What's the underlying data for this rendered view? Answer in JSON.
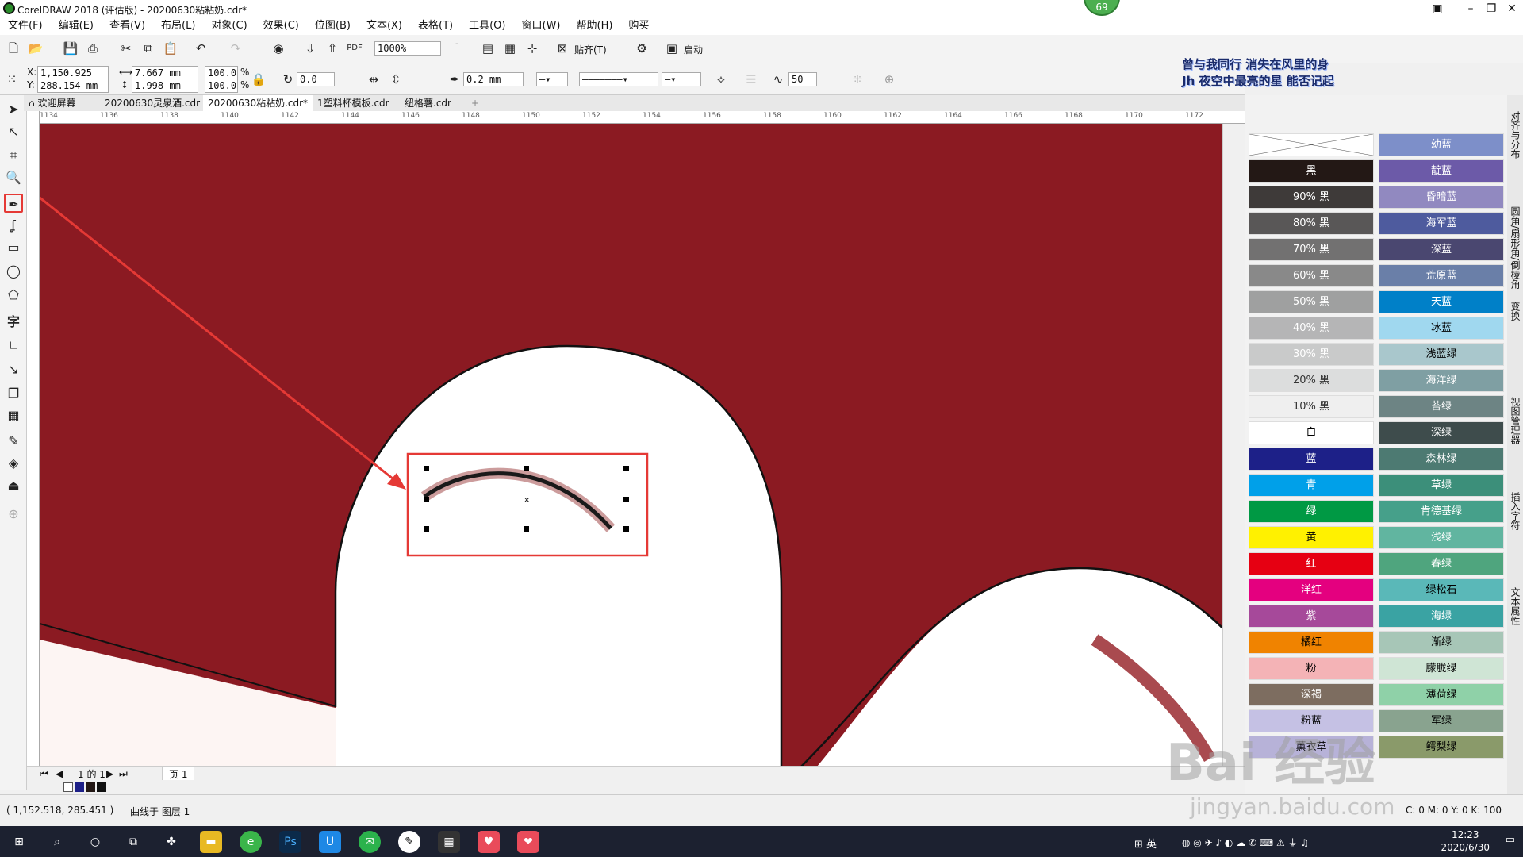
{
  "window": {
    "title": "CorelDRAW 2018 (评估版) - 20200630粘粘奶.cdr*",
    "badge": "69"
  },
  "menu": [
    "文件(F)",
    "编辑(E)",
    "查看(V)",
    "布局(L)",
    "对象(C)",
    "效果(C)",
    "位图(B)",
    "文本(X)",
    "表格(T)",
    "工具(O)",
    "窗口(W)",
    "帮助(H)",
    "购买"
  ],
  "toolbar": {
    "zoom": "1000%",
    "snap_label": "贴齐(T)",
    "launch_label": "启动"
  },
  "property_bar": {
    "x": "1,150.925 mm",
    "y": "288.154 mm",
    "width": "7.667 mm",
    "height": "1.998 mm",
    "scale_x": "100.0",
    "scale_y": "100.0",
    "pct": "%",
    "rotation": "0.0",
    "outline_width": "0.2 mm",
    "smoothing": "50"
  },
  "promo": {
    "line1": "曾与我同行 消失在风里的身",
    "line2": "Jh 夜空中最亮的星 能否记起"
  },
  "doc_tabs": [
    "欢迎屏幕",
    "20200630灵泉酒.cdr",
    "20200630粘粘奶.cdr*",
    "1塑料杯模板.cdr",
    "纽格薯.cdr"
  ],
  "ruler_ticks": [
    "1134",
    "1136",
    "1138",
    "1140",
    "1142",
    "1144",
    "1146",
    "1148",
    "1150",
    "1152",
    "1154",
    "1156",
    "1158",
    "1160",
    "1162",
    "1164",
    "1166",
    "1168",
    "1170",
    "1172"
  ],
  "palette": {
    "left": [
      {
        "label": "",
        "color": "#ffffff",
        "text": "#000"
      },
      {
        "label": "黑",
        "color": "#231815",
        "text": "#fff"
      },
      {
        "label": "90% 黑",
        "color": "#3e3a39",
        "text": "#fff"
      },
      {
        "label": "80% 黑",
        "color": "#595757",
        "text": "#fff"
      },
      {
        "label": "70% 黑",
        "color": "#727171",
        "text": "#fff"
      },
      {
        "label": "60% 黑",
        "color": "#898989",
        "text": "#fff"
      },
      {
        "label": "50% 黑",
        "color": "#9fa0a0",
        "text": "#fff"
      },
      {
        "label": "40% 黑",
        "color": "#b5b5b6",
        "text": "#fff"
      },
      {
        "label": "30% 黑",
        "color": "#c9caca",
        "text": "#fff"
      },
      {
        "label": "20% 黑",
        "color": "#dcdddd",
        "text": "#333"
      },
      {
        "label": "10% 黑",
        "color": "#efefef",
        "text": "#333"
      },
      {
        "label": "白",
        "color": "#ffffff",
        "text": "#000"
      },
      {
        "label": "蓝",
        "color": "#1d2088",
        "text": "#fff"
      },
      {
        "label": "青",
        "color": "#00a0e9",
        "text": "#fff"
      },
      {
        "label": "绿",
        "color": "#009944",
        "text": "#fff"
      },
      {
        "label": "黄",
        "color": "#fff100",
        "text": "#000"
      },
      {
        "label": "红",
        "color": "#e60012",
        "text": "#fff"
      },
      {
        "label": "洋红",
        "color": "#e4007f",
        "text": "#fff"
      },
      {
        "label": "紫",
        "color": "#a6499a",
        "text": "#fff"
      },
      {
        "label": "橘红",
        "color": "#f08300",
        "text": "#000"
      },
      {
        "label": "粉",
        "color": "#f4b3b6",
        "text": "#000"
      },
      {
        "label": "深褐",
        "color": "#7d6d60",
        "text": "#fff"
      },
      {
        "label": "粉蓝",
        "color": "#c5c1e4",
        "text": "#000"
      },
      {
        "label": "薰衣草",
        "color": "#b7b2d8",
        "text": "#000"
      }
    ],
    "right": [
      {
        "label": "幼蓝",
        "color": "#7d8fc9",
        "text": "#fff"
      },
      {
        "label": "靛蓝",
        "color": "#6c5aa8",
        "text": "#fff"
      },
      {
        "label": "昏暗蓝",
        "color": "#9189c0",
        "text": "#fff"
      },
      {
        "label": "海军蓝",
        "color": "#4e5b9e",
        "text": "#fff"
      },
      {
        "label": "深蓝",
        "color": "#4a4770",
        "text": "#fff"
      },
      {
        "label": "荒原蓝",
        "color": "#6a7fa8",
        "text": "#fff"
      },
      {
        "label": "天蓝",
        "color": "#0080c8",
        "text": "#fff"
      },
      {
        "label": "冰蓝",
        "color": "#a0d8ef",
        "text": "#000"
      },
      {
        "label": "浅蓝绿",
        "color": "#a9c7cc",
        "text": "#000"
      },
      {
        "label": "海洋绿",
        "color": "#7f9fa3",
        "text": "#fff"
      },
      {
        "label": "苔绿",
        "color": "#6d8484",
        "text": "#fff"
      },
      {
        "label": "深绿",
        "color": "#3e4c4c",
        "text": "#fff"
      },
      {
        "label": "森林绿",
        "color": "#4d7a72",
        "text": "#fff"
      },
      {
        "label": "草绿",
        "color": "#3c8f7a",
        "text": "#fff"
      },
      {
        "label": "肯德基绿",
        "color": "#46a08a",
        "text": "#fff"
      },
      {
        "label": "浅绿",
        "color": "#61b5a0",
        "text": "#fff"
      },
      {
        "label": "春绿",
        "color": "#4fa57e",
        "text": "#fff"
      },
      {
        "label": "绿松石",
        "color": "#5ab8b8",
        "text": "#000"
      },
      {
        "label": "海绿",
        "color": "#3aa3a3",
        "text": "#fff"
      },
      {
        "label": "渐绿",
        "color": "#a7c6b7",
        "text": "#000"
      },
      {
        "label": "朦胧绿",
        "color": "#cfe5d5",
        "text": "#000"
      },
      {
        "label": "薄荷绿",
        "color": "#8fd1a8",
        "text": "#000"
      },
      {
        "label": "军绿",
        "color": "#89a38f",
        "text": "#000"
      },
      {
        "label": "鳄梨绿",
        "color": "#8a9a6a",
        "text": "#000"
      }
    ]
  },
  "docker_tabs": [
    "对齐与分布",
    "圆角/扇形角/倒棱角",
    "变换",
    "视图管理器",
    "插入字符",
    "文本属性"
  ],
  "page_nav": {
    "page_info": "1 的 1",
    "page_tab": "页 1"
  },
  "status": {
    "coords": "( 1,152.518, 285.451 )",
    "object_info": "曲线于 图层 1",
    "color_info": "C: 0 M: 0 Y: 0 K: 100"
  },
  "taskbar": {
    "time": "12:23",
    "date": "2020/6/30",
    "ime": "英"
  },
  "watermark": {
    "brand": "Bai 经验",
    "url": "jingyan.baidu.com"
  },
  "colors": {
    "canvas_red": "#8b1a22",
    "highlight": "#e53935"
  }
}
